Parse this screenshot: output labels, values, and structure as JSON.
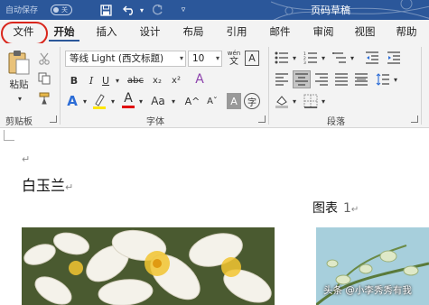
{
  "titlebar": {
    "autosave_label": "自动保存",
    "autosave_state": "关",
    "doc_title": "页码草稿",
    "save_icon": "save-icon",
    "undo_icon": "undo-icon",
    "redo_icon": "redo-icon"
  },
  "tabs": [
    "文件",
    "开始",
    "插入",
    "设计",
    "布局",
    "引用",
    "邮件",
    "审阅",
    "视图",
    "帮助"
  ],
  "active_tab": "开始",
  "highlight_color": "#d9261c",
  "ribbon": {
    "clipboard": {
      "paste_label": "粘贴",
      "group_label": "剪贴板"
    },
    "font": {
      "font_name": "等线 Light (西文标题)",
      "font_size": "10",
      "wen_glyph": "wén",
      "char_border": "A",
      "bold": "B",
      "italic": "I",
      "underline": "U",
      "strike": "abc",
      "subscript": "x₂",
      "superscript": "x²",
      "clear_format": "A",
      "text_effect": "A",
      "highlight": "ab",
      "font_color": "A",
      "case": "Aa",
      "grow": "A^",
      "shrink": "Aˇ",
      "char_shading": "A",
      "enclose": "字",
      "group_label": "字体"
    },
    "paragraph": {
      "group_label": "段落"
    }
  },
  "document": {
    "heading": "白玉兰",
    "caption_word": "图表",
    "caption_num": "1",
    "para_mark": "↵"
  },
  "watermark": {
    "text": "头条 @小李秀秀有我"
  }
}
